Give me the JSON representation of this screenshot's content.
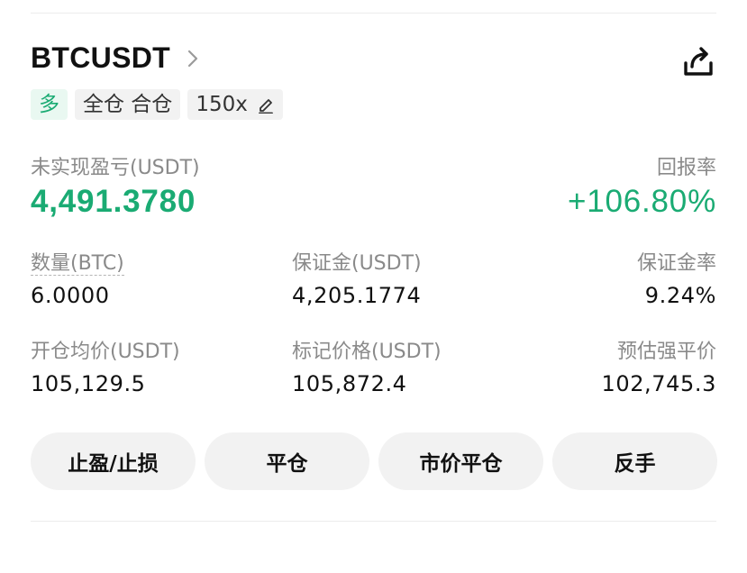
{
  "position": {
    "symbol": "BTCUSDT",
    "tags": {
      "side": "多",
      "margin_mode": "全仓 合仓",
      "leverage": "150x"
    },
    "pnl": {
      "label": "未实现盈亏(USDT)",
      "value": "4,491.3780"
    },
    "roi": {
      "label": "回报率",
      "value": "+106.80%"
    },
    "stats_row1": [
      {
        "label": "数量(BTC)",
        "value": "6.0000"
      },
      {
        "label": "保证金(USDT)",
        "value": "4,205.1774"
      },
      {
        "label": "保证金率",
        "value": "9.24%"
      }
    ],
    "stats_row2": [
      {
        "label": "开仓均价(USDT)",
        "value": "105,129.5"
      },
      {
        "label": "标记价格(USDT)",
        "value": "105,872.4"
      },
      {
        "label": "预估强平价",
        "value": "102,745.3"
      }
    ]
  },
  "actions": {
    "tp_sl": "止盈/止损",
    "close": "平仓",
    "market_close": "市价平仓",
    "reverse": "反手"
  },
  "icons": {
    "chevron": "chevron-right-icon",
    "share": "share-icon",
    "edit": "edit-icon"
  },
  "colors": {
    "profit_green": "#1aab73",
    "long_tag_bg": "#e9f8f1",
    "chip_bg": "#f2f2f2",
    "muted_text": "#8a8a8a"
  }
}
